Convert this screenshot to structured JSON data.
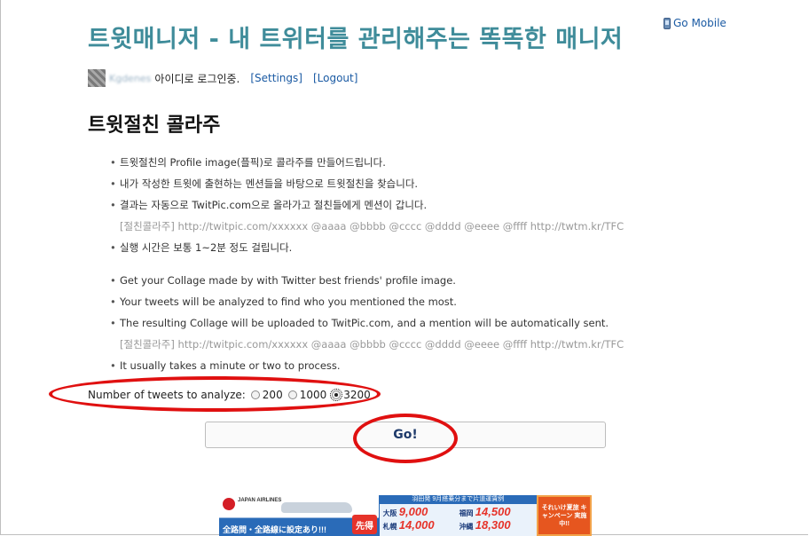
{
  "header": {
    "title": "트윗매니저 - 내 트위터를 관리해주는 똑똑한 매니저",
    "go_mobile": "Go Mobile"
  },
  "userbar": {
    "username": "Kgdenes",
    "login_text": "아이디로 로그인중.",
    "settings": "[Settings]",
    "logout": "[Logout]"
  },
  "section_title": "트윗절친 콜라주",
  "korean_list": [
    "트윗절친의 Profile image(플픽)로 콜라주를 만들어드립니다.",
    "내가 작성한 트윗에 출현하는 멘션들을 바탕으로 트윗절친을 찾습니다.",
    "결과는 자동으로 TwitPic.com으로 올라가고 절친들에게 멘션이 갑니다.",
    "[절친콜라주] http://twitpic.com/xxxxxx @aaaa @bbbb @cccc @dddd @eeee @ffff http://twtm.kr/TFC",
    "실행 시간은 보통 1~2분 정도 걸립니다."
  ],
  "english_list": [
    "Get your Collage made by with Twitter best friends' profile image.",
    "Your tweets will be analyzed to find who you mentioned the most.",
    "The resulting Collage will be uploaded to TwitPic.com, and a mention will be automatically sent.",
    "[절친콜라주] http://twitpic.com/xxxxxx @aaaa @bbbb @cccc @dddd @eeee @ffff http://twtm.kr/TFC",
    "It usually takes a minute or two to process."
  ],
  "analyze": {
    "label": "Number of tweets to analyze:",
    "options": [
      "200",
      "1000",
      "3200"
    ],
    "selected": "3200"
  },
  "go_button": "Go!",
  "ad": {
    "airline": "JAPAN AIRLINES",
    "left_text": "全路問・全路線に設定あり!!!",
    "sale": "先得",
    "header": "羽田発 9月搭乗分まで片道運賃例",
    "fares": [
      {
        "city": "大阪",
        "price": "9,000"
      },
      {
        "city": "福岡",
        "price": "14,500"
      },
      {
        "city": "札幌",
        "price": "14,000"
      },
      {
        "city": "沖縄",
        "price": "18,300"
      }
    ],
    "right_text": "それいけ夏旅 キャンペーン 実施中!!"
  },
  "colors": {
    "title": "#3f8c9a",
    "link": "#1a5aa3",
    "annotation_red": "#e01010",
    "example_gray": "#999999"
  }
}
